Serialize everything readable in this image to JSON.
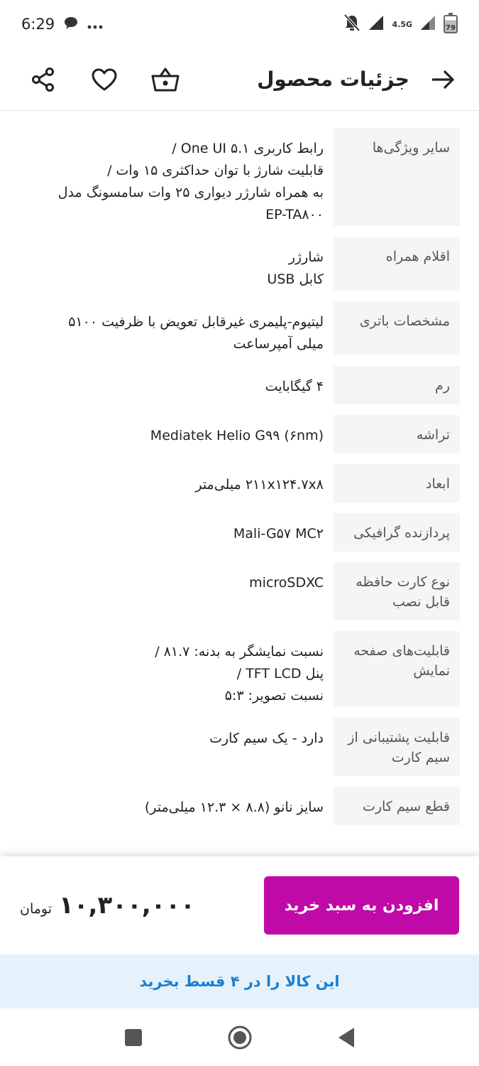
{
  "status_bar": {
    "time": "6:29",
    "network": "4.5G",
    "battery": "79"
  },
  "header": {
    "title": "جزئیات محصول"
  },
  "icons": {
    "share": "share-icon",
    "favorite": "heart-icon",
    "cart": "basket-icon",
    "back": "arrow-right-icon"
  },
  "specs": [
    {
      "label": "سایر ویژگی‌ها",
      "value_lines": [
        "رابط کاربری One UI ۵.۱ /",
        "قابلیت شارژ با توان حداکثری ۱۵ وات /",
        "به همراه شارژر دیواری ۲۵ وات سامسونگ مدل",
        "EP-TA۸۰۰"
      ]
    },
    {
      "label": "اقلام همراه",
      "value_lines": [
        "شارژر",
        "کابل USB"
      ]
    },
    {
      "label": "مشخصات باتری",
      "value_lines": [
        "لیتیوم-پلیمری غیرقابل تعویض با ظرفیت ۵۱۰۰",
        "میلی آمپرساعت"
      ]
    },
    {
      "label": "رم",
      "value_lines": [
        "۴ گیگابایت"
      ]
    },
    {
      "label": "تراشه",
      "value_lines": [
        "Mediatek Helio G۹۹ (۶nm)"
      ]
    },
    {
      "label": "ابعاد",
      "value_lines": [
        "۲۱۱x۱۲۴.۷x۸ میلی‌متر"
      ]
    },
    {
      "label": "پردازنده گرافیکی",
      "value_lines": [
        "Mali-G۵۷ MC۲"
      ]
    },
    {
      "label": "نوع کارت حافظه قابل نصب",
      "value_lines": [
        "microSDXC"
      ]
    },
    {
      "label": "قابلیت‌های صفحه نمایش",
      "value_lines": [
        "نسبت نمایشگر به بدنه: ۸۱.۷ /",
        "پنل TFT LCD /",
        "نسبت تصویر: ۵:۳"
      ]
    },
    {
      "label": "قابلیت پشتیبانی از سیم کارت",
      "value_lines": [
        "دارد - یک سیم کارت"
      ]
    },
    {
      "label": "قطع سیم کارت",
      "value_lines": [
        "سایز نانو (۸.۸ × ۱۲.۳ میلی‌متر)"
      ]
    }
  ],
  "purchase": {
    "price": "۱۰,۳۰۰,۰۰۰",
    "currency": "تومان",
    "add_to_cart_label": "افزودن به سبد خرید"
  },
  "installment": {
    "text": "این کالا را در ۴ قسط بخرید"
  },
  "nav": {
    "recents": "recents-icon",
    "home": "home-icon",
    "back": "back-triangle-icon"
  }
}
